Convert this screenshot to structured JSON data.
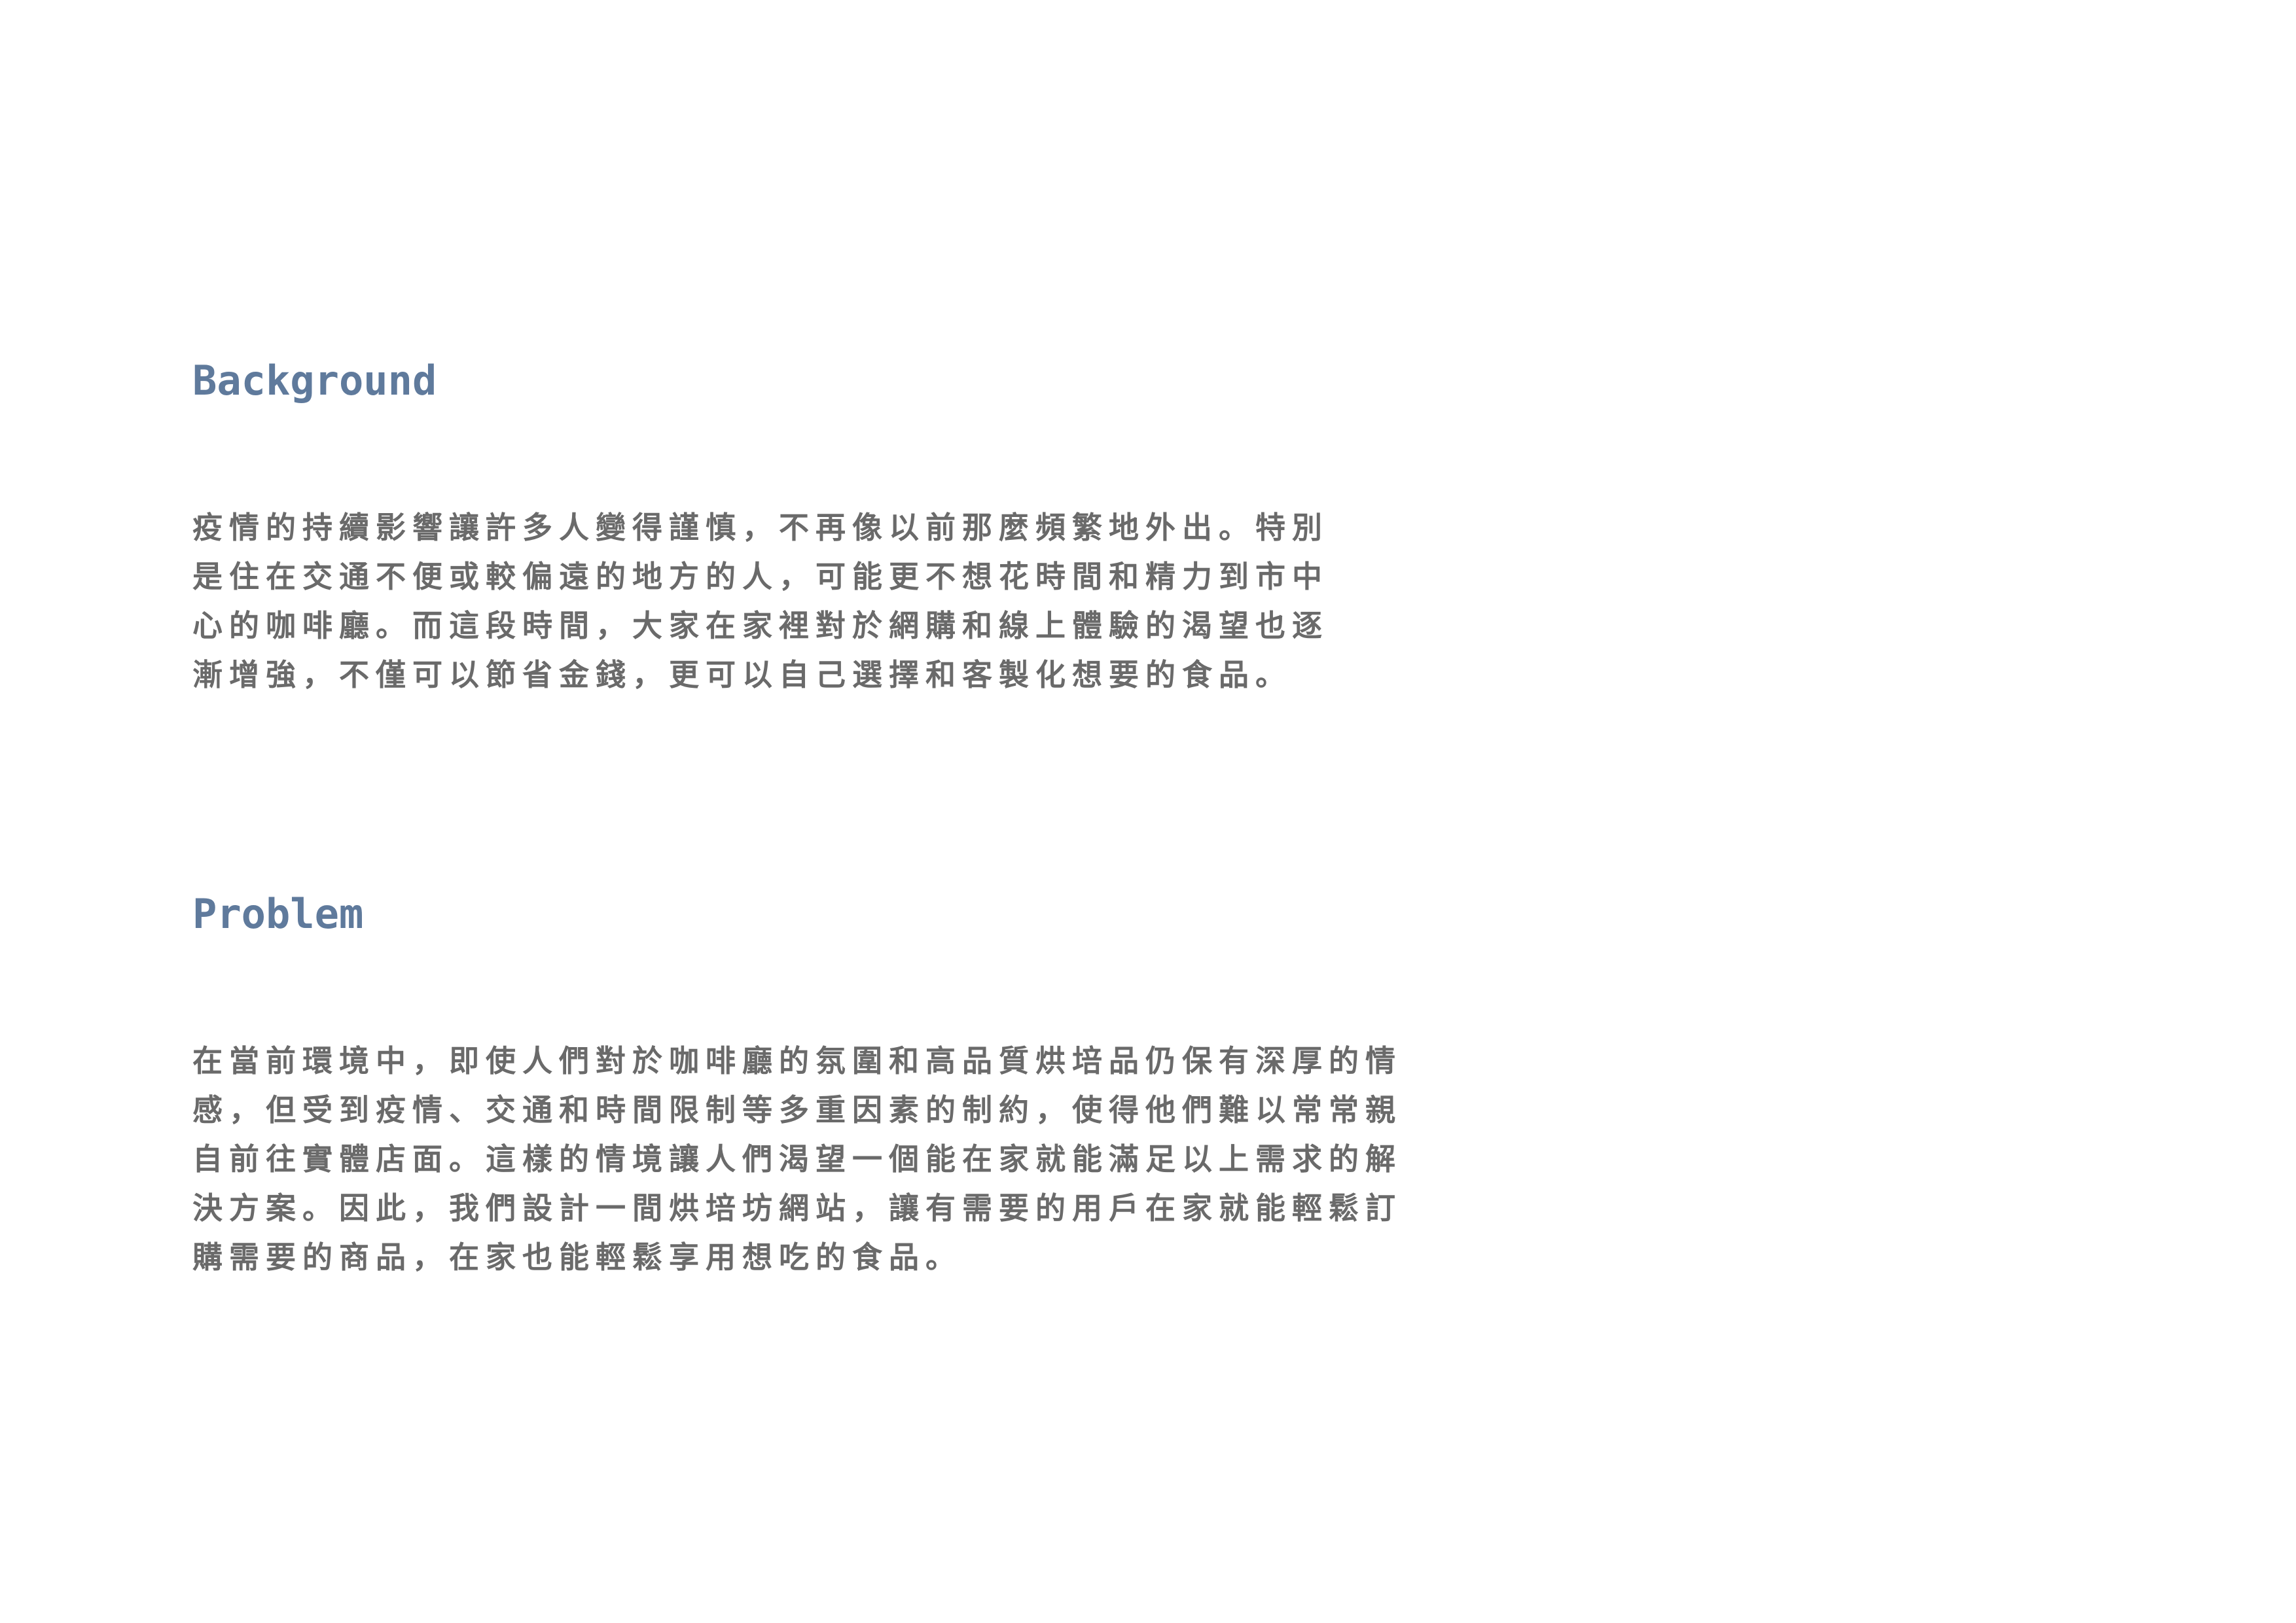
{
  "background": {
    "heading": "Background",
    "lines": [
      "疫情的持續影響讓許多人變得謹慎，不再像以前那麼頻繁地外出。特別",
      "是住在交通不便或較偏遠的地方的人，可能更不想花時間和精力到市中",
      "心的咖啡廳。而這段時間，大家在家裡對於網購和線上體驗的渴望也逐",
      "漸增強，不僅可以節省金錢，更可以自己選擇和客製化想要的食品。"
    ]
  },
  "problem": {
    "heading": "Problem",
    "lines": [
      "在當前環境中，即使人們對於咖啡廳的氛圍和高品質烘培品仍保有深厚的情",
      "感，但受到疫情、交通和時間限制等多重因素的制約，使得他們難以常常親",
      "自前往實體店面。這樣的情境讓人們渴望一個能在家就能滿足以上需求的解",
      "決方案。因此，我們設計一間烘培坊網站，讓有需要的用戶在家就能輕鬆訂",
      "購需要的商品，在家也能輕鬆享用想吃的食品。"
    ]
  }
}
